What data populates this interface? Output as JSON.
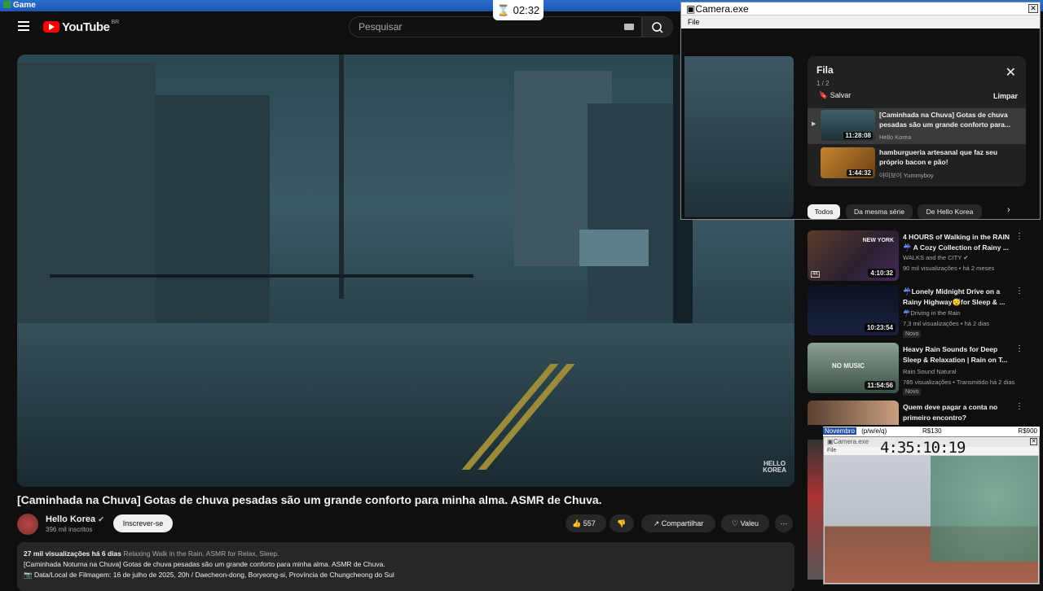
{
  "game_bar": {
    "title": "Game"
  },
  "timer": {
    "icon": "hourglass-icon",
    "value": "02:32"
  },
  "header": {
    "logo_text": "YouTube",
    "logo_region": "BR",
    "search_placeholder": "Pesquisar"
  },
  "video": {
    "watermark_line1": "HELLO",
    "watermark_line2": "KOREA",
    "title": "[Caminhada na Chuva] Gotas de chuva pesadas são um grande conforto para minha alma. ASMR de Chuva."
  },
  "channel": {
    "name": "Hello Korea",
    "subscribers": "396 mil inscritos",
    "subscribe_label": "Inscrever-se"
  },
  "actions": {
    "likes": "557",
    "share_label": "Compartilhar",
    "thanks_label": "Valeu",
    "more": "⋯"
  },
  "description": {
    "views_date": "27 mil visualizações  há 6 dias",
    "tags": "Relaxing Walk in the Rain. ASMR for Relax, Sleep.",
    "line1": "[Caminhada Noturna na Chuva] Gotas de chuva pesadas são um grande conforto para minha alma. ASMR de Chuva.",
    "line2": "📷 Data/Local de Filmagem: 16 de julho de 2025, 20h / Daecheon-dong, Boryeong-si, Província de Chungcheong do Sul"
  },
  "camera_window_1": {
    "title": "Camera.exe",
    "menu_file": "File"
  },
  "queue": {
    "title": "Fila",
    "count": "1 / 2",
    "save_label": "Salvar",
    "clear_label": "Limpar",
    "items": [
      {
        "title": "[Caminhada na Chuva] Gotas de chuva pesadas são um grande conforto para...",
        "channel": "Hello Korea",
        "duration": "11:28:08"
      },
      {
        "title": "hamburgueria artesanal que faz seu próprio bacon e pão!",
        "channel": "야미보이 Yummyboy",
        "duration": "1:44:32"
      }
    ]
  },
  "chips": [
    "Todos",
    "Da mesma série",
    "De Hello Korea"
  ],
  "recommendations": [
    {
      "title": "4 HOURS of Walking in the RAIN ☔ A Cozy Collection of Rainy ...",
      "channel": "WALKS and the CITY",
      "meta": "90 mil visualizações • há 2 meses",
      "duration": "4:10:32",
      "badge": "",
      "thumb_text": "NEW YORK"
    },
    {
      "title": "☔Lonely Midnight Drive on a Rainy Highway😴for Sleep & ...",
      "channel": "☔Driving in the Rain",
      "meta": "7,3 mil visualizações • há 2 dias",
      "duration": "10:23:54",
      "badge": "Novo",
      "thumb_text": ""
    },
    {
      "title": "Heavy Rain Sounds for Deep Sleep & Relaxation | Rain on T...",
      "channel": "Rain Sound Natural",
      "meta": "785 visualizações • Transmitido há 2 dias",
      "duration": "11:54:56",
      "badge": "Novo",
      "thumb_text": "NO MUSIC"
    },
    {
      "title": "Quem deve pagar a conta no primeiro encontro?",
      "channel": "",
      "meta": "",
      "duration": "",
      "badge": "",
      "thumb_text": ""
    }
  ],
  "tracker": {
    "month": "Novembro",
    "hint": "(p/w/e/q)",
    "value1": "R$130",
    "value2": "R$900"
  },
  "camera_window_2": {
    "title": "Camera.exe",
    "menu_file": "File",
    "clock": "4:35:10:19"
  }
}
